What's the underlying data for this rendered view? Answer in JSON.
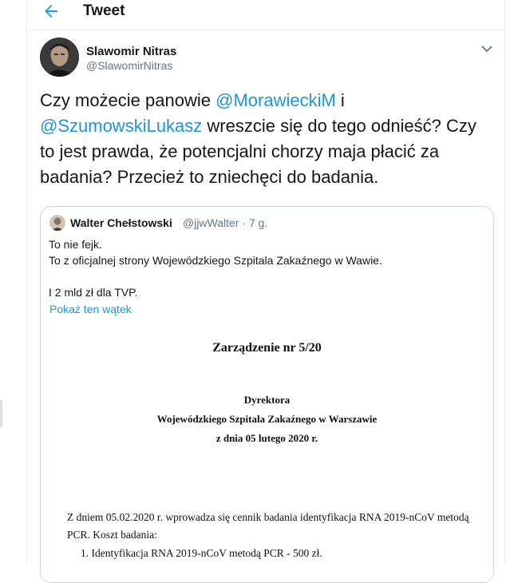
{
  "header": {
    "title": "Tweet"
  },
  "tweet": {
    "author_name": "Slawomir Nitras",
    "author_handle": "@SlawomirNitras",
    "text_part1": "Czy możecie panowie ",
    "mention1": "@MorawieckiM",
    "text_part2": " i ",
    "mention2": "@SzumowskiLukasz",
    "text_part3": " wreszcie się do tego odnieść? Czy to jest prawda, że potencjalni chorzy maja płacić za badania? Przecież to zniechęci do badania."
  },
  "quoted_tweet": {
    "author_name": "Walter Chełstowski",
    "author_handle": "@jjwWalter",
    "time": "7 g.",
    "lines": [
      "To nie fejk.",
      "To z oficjalnej strony Wojewódzkiego Szpitala Zakaźnego w Wawie.",
      "",
      "I 2 mld zł dla TVP."
    ],
    "show_thread": "Pokaż ten wątek"
  },
  "document": {
    "title": "Zarządzenie nr 5/20",
    "heading_line1": "Dyrektora",
    "heading_line2": "Wojewódzkiego Szpitala Zakaźnego w Warszawie",
    "heading_line3": "z dnia 05  lutego 2020 r.",
    "body": "Z dniem 05.02.2020 r. wprowadza się cennik badania identyfikacja RNA 2019-nCoV metodą PCR. Koszt badania:",
    "item": "1.   Identyfikacja RNA 2019-nCoV metodą  PCR - 500 zł."
  },
  "colors": {
    "link": "#1b95e0",
    "secondary_text": "#657786",
    "border": "#e6ecf0"
  },
  "icons": [
    "back-arrow-icon",
    "chevron-down-icon"
  ]
}
